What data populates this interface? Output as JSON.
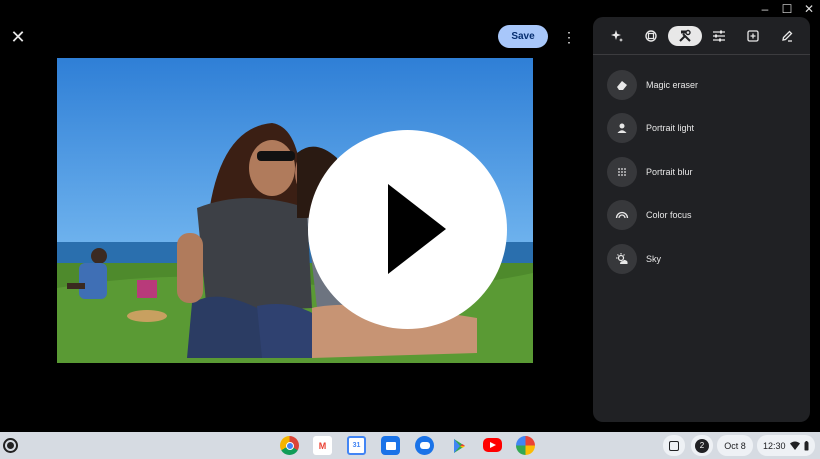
{
  "toolbar": {
    "close_glyph": "✕",
    "save_label": "Save",
    "more_glyph": "⋮"
  },
  "window_controls": [
    "–",
    "☐",
    "✕"
  ],
  "panel": {
    "tools": [
      {
        "name": "sparkle-icon"
      },
      {
        "name": "rotate-crop-icon"
      },
      {
        "name": "tools-icon",
        "active": true
      },
      {
        "name": "adjust-sliders-icon"
      },
      {
        "name": "add-image-icon"
      },
      {
        "name": "markup-pen-icon"
      }
    ],
    "options": [
      {
        "label": "Magic eraser",
        "icon": "eraser-icon"
      },
      {
        "label": "Portrait light",
        "icon": "portrait-light-icon"
      },
      {
        "label": "Portrait blur",
        "icon": "portrait-blur-icon"
      },
      {
        "label": "Color focus",
        "icon": "color-focus-icon"
      },
      {
        "label": "Sky",
        "icon": "sky-icon"
      }
    ]
  },
  "shelf": {
    "apps": [
      {
        "name": "chrome-icon",
        "color": "#db4437"
      },
      {
        "name": "gmail-icon",
        "color": "#ea4335"
      },
      {
        "name": "calendar-icon",
        "color": "#4285f4"
      },
      {
        "name": "files-icon",
        "color": "#1a73e8"
      },
      {
        "name": "messages-icon",
        "color": "#1a73e8"
      },
      {
        "name": "play-store-icon",
        "color": "#34a853"
      },
      {
        "name": "youtube-icon",
        "color": "#ff0000"
      },
      {
        "name": "photos-icon",
        "color": "#fbbc04"
      }
    ],
    "notification_count": "2",
    "date": "Oct 8",
    "time": "12:30"
  },
  "colors": {
    "save_bg": "#a8c7fa",
    "panel_bg": "#202124",
    "shelf_bg": "#d6dbe2"
  }
}
